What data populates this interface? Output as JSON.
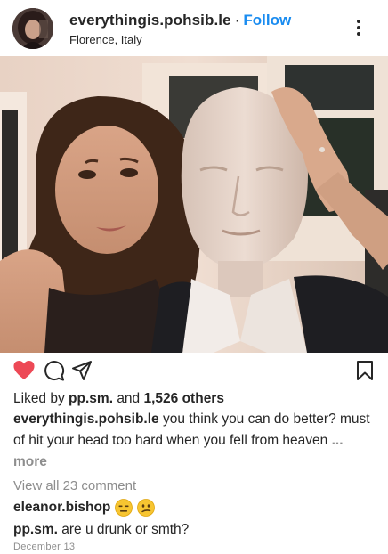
{
  "post": {
    "username": "everythingis.pohsib.le",
    "separator": "·",
    "follow_label": "Follow",
    "location": "Florence, Italy"
  },
  "icons": {
    "avatar": "profile-avatar",
    "more": "more-options-icon",
    "like": "heart-filled-icon",
    "comment": "comment-bubble-icon",
    "share": "paper-plane-icon",
    "save": "bookmark-icon",
    "emoji_1": "expressionless-face-emoji",
    "emoji_2": "confused-face-emoji"
  },
  "colors": {
    "like_red": "#ed4956",
    "follow_blue": "#1a8cf0",
    "muted_gray": "#8e8e8e"
  },
  "likes": {
    "prefix": "Liked by",
    "user": "pp.sm.",
    "middle": "and",
    "count": "1,526 others"
  },
  "caption": {
    "user": "everythingis.pohsib.le",
    "text": "you think you can do better? must of hit your head too hard when you fell from heaven",
    "more_label": "... more"
  },
  "comments": {
    "view_all": "View all 23 comment",
    "items": [
      {
        "user": "eleanor.bishop",
        "text": ""
      },
      {
        "user": "pp.sm.",
        "text": "are u drunk or smth?"
      }
    ]
  },
  "date": "December 13"
}
